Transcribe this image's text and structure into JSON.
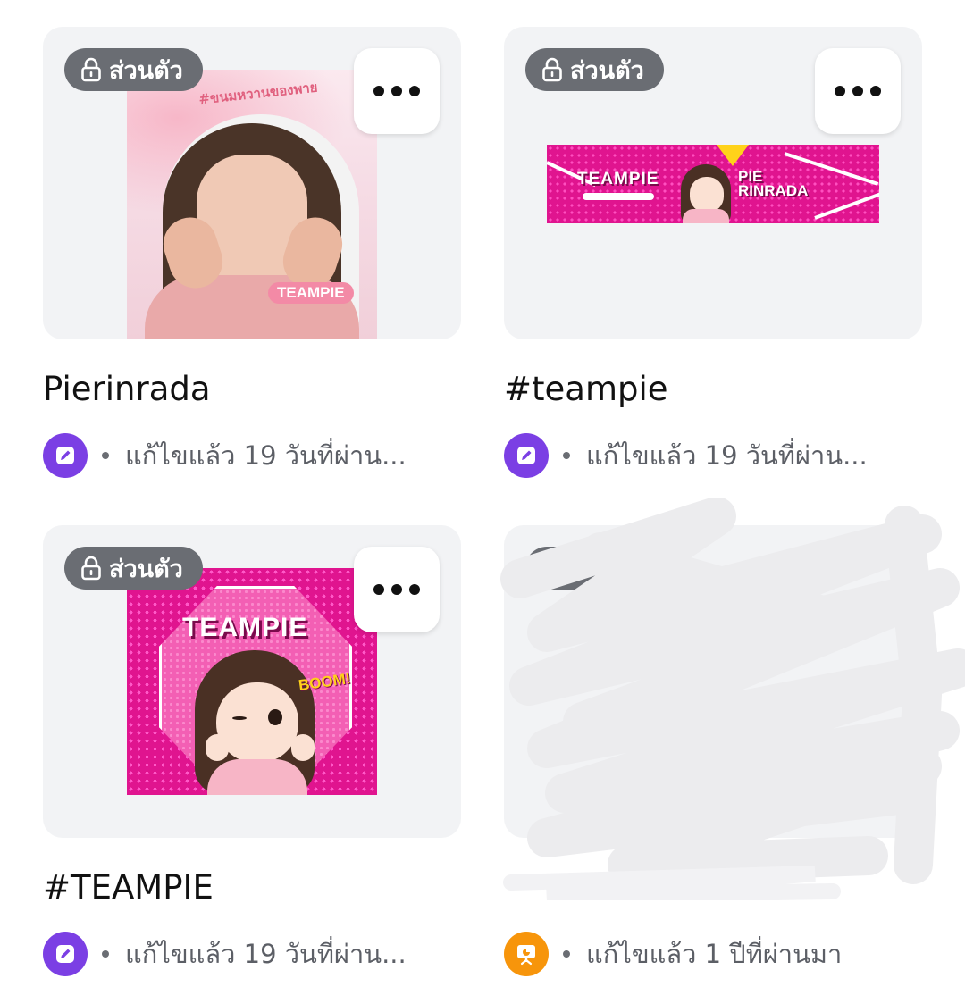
{
  "colors": {
    "badge_bg": "#6a6d73",
    "edit_icon_bg": "#7b3fe4",
    "present_icon_bg": "#f7950b",
    "card_bg": "#f2f3f5",
    "design_pink": "#e0148f"
  },
  "designs": [
    {
      "privacy_label": "ส่วนตัว",
      "title": "Pierinrada",
      "edited_label": "แก้ไขแล้ว 19 วันที่ผ่าน...",
      "type_icon": "edit-icon",
      "thumbnail": {
        "kind": "photo",
        "caption": "#ขนมหวานของพาย",
        "tag": "TEAMPIE"
      }
    },
    {
      "privacy_label": "ส่วนตัว",
      "title": "#teampie",
      "edited_label": "แก้ไขแล้ว 19 วันที่ผ่าน...",
      "type_icon": "edit-icon",
      "thumbnail": {
        "kind": "banner",
        "headline": "TEAMPIE",
        "name_line_1": "PIE",
        "name_line_2": "RINRADA"
      }
    },
    {
      "privacy_label": "ส่วนตัว",
      "title": "#TEAMPIE",
      "edited_label": "แก้ไขแล้ว 19 วันที่ผ่าน...",
      "type_icon": "edit-icon",
      "thumbnail": {
        "kind": "poster",
        "headline": "TEAMPIE",
        "sticker": "BOOM!"
      }
    },
    {
      "title": "",
      "edited_label": "แก้ไขแล้ว 1 ปีที่ผ่านมา",
      "type_icon": "presentation-icon",
      "redacted": true
    }
  ]
}
